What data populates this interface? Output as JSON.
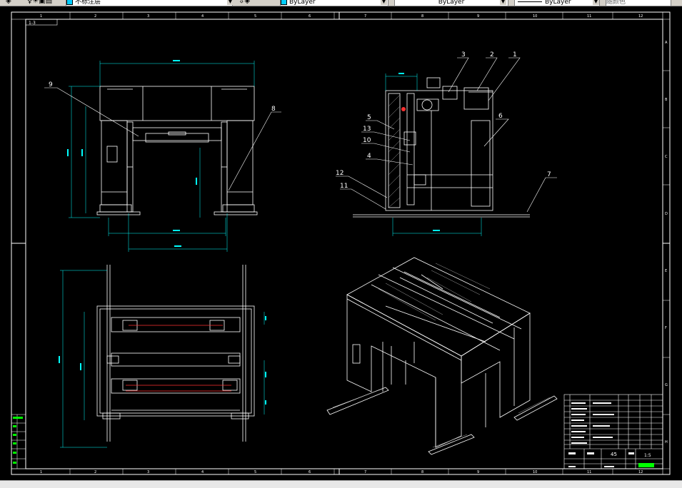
{
  "toolbar": {
    "layer_name": "不标注层",
    "color_value": "ByLayer",
    "linetype_value": "ByLayer",
    "lineweight_value": "ByLayer",
    "plotstyle_value": "随颜色"
  },
  "drawing": {
    "frame_tag": "1-3",
    "column_numbers": [
      "1",
      "2",
      "3",
      "4",
      "5",
      "6",
      "7",
      "8",
      "9",
      "10",
      "11",
      "12"
    ],
    "row_letters": [
      "A",
      "B",
      "C",
      "D",
      "E",
      "F",
      "G",
      "H"
    ],
    "callouts": {
      "c1": "1",
      "c2": "2",
      "c3": "3",
      "c4": "4",
      "c5": "5",
      "c6": "6",
      "c7": "7",
      "c8": "8",
      "c9": "9",
      "c10": "10",
      "c11": "11",
      "c12": "12",
      "c13": "13"
    },
    "title_block": {
      "number": "45",
      "scale": "1:5"
    }
  },
  "colors": {
    "frame": "#ffffff",
    "dimension": "#00ffff",
    "geometry": "#ffffff",
    "centerline": "#ff3030",
    "hatch": "#a0a0a0",
    "leader_text": "#ffffff",
    "title_green": "#00ff00"
  }
}
